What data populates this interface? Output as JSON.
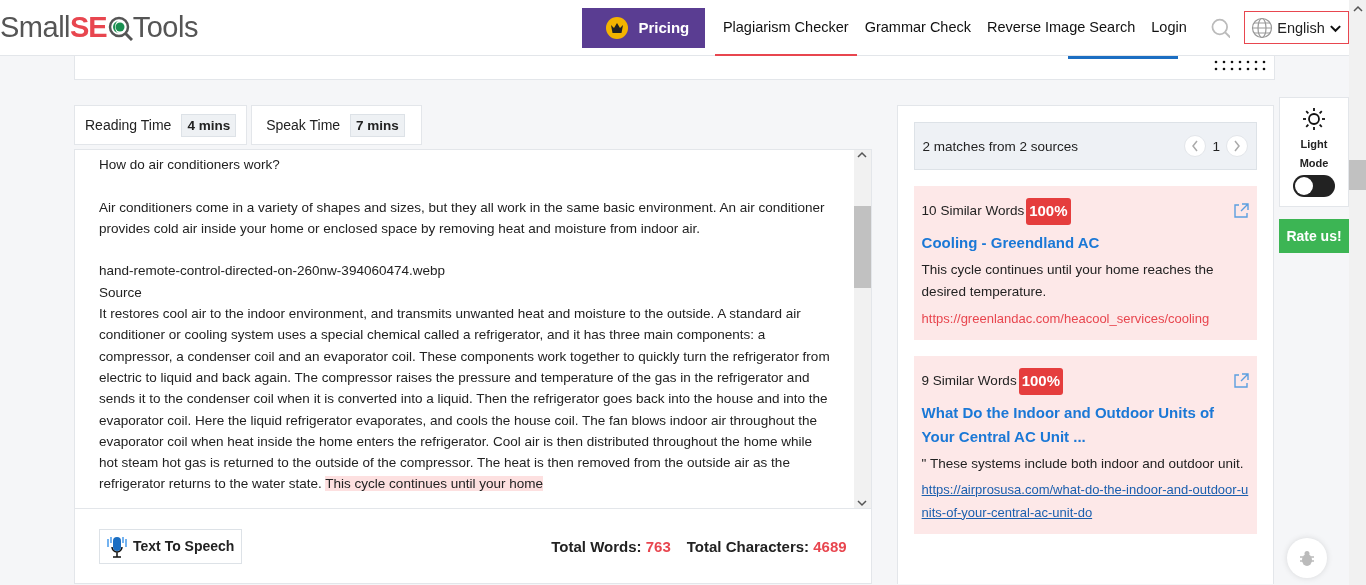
{
  "header": {
    "logo": {
      "part_1": "Small",
      "part_2": "SE",
      "part_3": "Tools"
    },
    "pricing": "Pricing",
    "nav": [
      {
        "label": "Plagiarism Checker",
        "selected": true
      },
      {
        "label": "Grammar Check",
        "selected": false
      },
      {
        "label": "Reverse Image Search",
        "selected": false
      },
      {
        "label": "Login",
        "selected": false
      }
    ],
    "language": "English"
  },
  "stats": [
    {
      "label": "Reading Time",
      "value": "4 mins"
    },
    {
      "label": "Speak Time",
      "value": "7 mins"
    }
  ],
  "document": {
    "blocks": [
      {
        "kind": "paragraph",
        "segments": [
          {
            "text": "How do air conditioners work?",
            "highlighted": false
          }
        ]
      },
      {
        "kind": "paragraph",
        "segments": [
          {
            "text": "Air conditioners come in a variety of shapes and sizes, but they all work in the same basic environment. An air conditioner provides cold air inside your home or enclosed space by removing heat and moisture from indoor air.",
            "highlighted": false
          }
        ]
      },
      {
        "kind": "line",
        "segments": [
          {
            "text": "hand-remote-control-directed-on-260nw-394060474.webp",
            "highlighted": false
          }
        ]
      },
      {
        "kind": "line",
        "segments": [
          {
            "text": "Source",
            "highlighted": false
          }
        ]
      },
      {
        "kind": "line",
        "segments": [
          {
            "text": "It restores cool air to the indoor environment, and transmits unwanted heat and moisture to the outside. A standard air conditioner or cooling system uses a special chemical called a refrigerator, and it has three main components: a compressor, a condenser coil and an evaporator coil. These components work together to quickly turn the refrigerator from electric to liquid and back again. The compressor raises the pressure and temperature of the gas in the refrigerator and sends it to the condenser coil when it is converted into a liquid. Then the refrigerator goes back into the house and into the evaporator coil. Here the liquid refrigerator evaporates, and cools the house coil. The fan blows indoor air throughout the evaporator coil when heat inside the home enters the refrigerator. Cool air is then distributed throughout the home while hot steam hot gas is returned to the outside of the compressor. The heat is then removed from the outside air as the refrigerator returns to the water state. ",
            "highlighted": false
          },
          {
            "text": "This cycle continues until your home",
            "highlighted": true
          }
        ]
      }
    ]
  },
  "footer": {
    "tts": "Text To Speech",
    "counts": [
      {
        "label": "Total Words:",
        "value": "763"
      },
      {
        "label": "Total Characters:",
        "value": "4689"
      }
    ]
  },
  "results": {
    "summary": "2 matches from 2 sources",
    "page": "1",
    "matches": [
      {
        "similar": "10 Similar Words",
        "percent": "100%",
        "title": "Cooling - Greendland AC",
        "snippet": "This cycle continues until your home reaches the desired temperature.",
        "url": "https://greenlandac.com/heacool_services/cooling",
        "hovered": false
      },
      {
        "similar": "9 Similar Words",
        "percent": "100%",
        "title": "What Do the Indoor and Outdoor Units of Your Central AC Unit ...",
        "snippet": "\" These systems include both indoor and outdoor unit.",
        "url": "https://airprosusa.com/what-do-the-indoor-and-outdoor-units-of-your-central-ac-unit-do",
        "hovered": true
      }
    ]
  },
  "side": {
    "mode_label": "Light Mode",
    "dark_mode": false,
    "rate": "Rate us!"
  }
}
